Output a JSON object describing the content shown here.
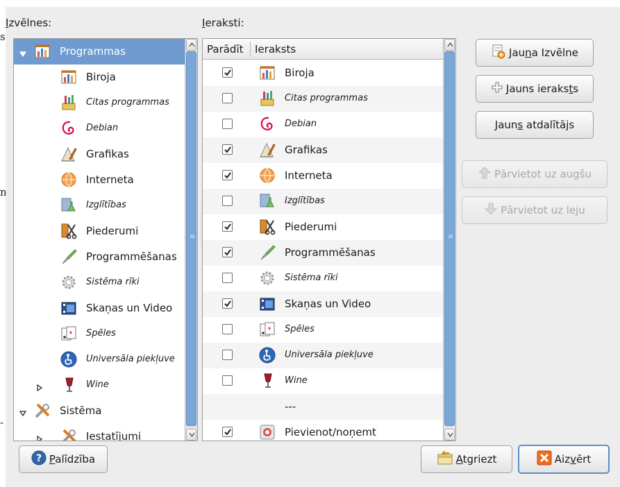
{
  "background": {
    "stray_glyphs": [
      "s",
      "n",
      "-"
    ]
  },
  "menus_panel": {
    "heading": "Izvēlnes:",
    "heading_mnemonic": "I",
    "heading_rest": "zvēlnes:",
    "items": [
      {
        "label": "Programmas",
        "icon": "office-chart-icon",
        "expander": "expanded",
        "selected": true,
        "italic": false,
        "level": 0
      },
      {
        "label": "Biroja",
        "icon": "office-chart-icon",
        "italic": false,
        "level": 1
      },
      {
        "label": "Citas programmas",
        "icon": "paint-brushes-icon",
        "italic": true,
        "level": 1
      },
      {
        "label": "Debian",
        "icon": "debian-swirl-icon",
        "italic": true,
        "level": 1
      },
      {
        "label": "Grafikas",
        "icon": "graphics-pen-icon",
        "italic": false,
        "level": 1
      },
      {
        "label": "Interneta",
        "icon": "internet-globe-icon",
        "italic": false,
        "level": 1
      },
      {
        "label": "Izglītības",
        "icon": "education-flask-icon",
        "italic": true,
        "level": 1
      },
      {
        "label": "Piederumi",
        "icon": "accessories-scissors-icon",
        "italic": false,
        "level": 1
      },
      {
        "label": "Programmēšanas",
        "icon": "trowel-icon",
        "italic": false,
        "level": 1
      },
      {
        "label": "Sistēma rīki",
        "icon": "gear-icon",
        "italic": true,
        "level": 1
      },
      {
        "label": "Skaņas un Video",
        "icon": "multimedia-film-icon",
        "italic": false,
        "level": 1
      },
      {
        "label": "Spēles",
        "icon": "playing-cards-icon",
        "italic": true,
        "level": 1
      },
      {
        "label": "Universāla piekļuve",
        "icon": "accessibility-icon",
        "italic": true,
        "level": 1
      },
      {
        "label": "Wine",
        "icon": "wine-glass-icon",
        "expander": "collapsed",
        "italic": true,
        "level": 1
      },
      {
        "label": "Sistēma",
        "icon": "tools-icon",
        "expander": "expanded",
        "italic": false,
        "level": 0
      },
      {
        "label": "Iestatījumi",
        "icon": "tools-icon",
        "expander": "collapsed",
        "italic": false,
        "level": 1
      }
    ]
  },
  "items_panel": {
    "heading": "Ieraksti:",
    "heading_mnemonic": "I",
    "heading_rest": "eraksti:",
    "columns": [
      "Parādīt",
      "Ieraksts"
    ],
    "rows": [
      {
        "show": true,
        "label": "Biroja",
        "icon": "office-chart-icon",
        "italic": false
      },
      {
        "show": false,
        "label": "Citas programmas",
        "icon": "paint-brushes-icon",
        "italic": true
      },
      {
        "show": false,
        "label": "Debian",
        "icon": "debian-swirl-icon",
        "italic": true
      },
      {
        "show": true,
        "label": "Grafikas",
        "icon": "graphics-pen-icon",
        "italic": false
      },
      {
        "show": true,
        "label": "Interneta",
        "icon": "internet-globe-icon",
        "italic": false
      },
      {
        "show": false,
        "label": "Izglītības",
        "icon": "education-flask-icon",
        "italic": true
      },
      {
        "show": true,
        "label": "Piederumi",
        "icon": "accessories-scissors-icon",
        "italic": false
      },
      {
        "show": true,
        "label": "Programmēšanas",
        "icon": "trowel-icon",
        "italic": false
      },
      {
        "show": false,
        "label": "Sistēma rīki",
        "icon": "gear-icon",
        "italic": true
      },
      {
        "show": true,
        "label": "Skaņas un Video",
        "icon": "multimedia-film-icon",
        "italic": false
      },
      {
        "show": false,
        "label": "Spēles",
        "icon": "playing-cards-icon",
        "italic": true
      },
      {
        "show": false,
        "label": "Universāla piekļuve",
        "icon": "accessibility-icon",
        "italic": true
      },
      {
        "show": false,
        "label": "Wine",
        "icon": "wine-glass-icon",
        "italic": true
      },
      {
        "separator": true,
        "label": "---"
      },
      {
        "show": true,
        "label": "Pievienot/noņemt",
        "icon": "add-remove-icon",
        "italic": false
      }
    ]
  },
  "actions": {
    "new_menu": {
      "label": "Jauna Izvēlne",
      "before": "Jau",
      "mnemonic": "n",
      "after": "a Izvēlne"
    },
    "new_item": {
      "label": "Jauns ieraksts",
      "before": "Jauns ieraks",
      "mnemonic": "t",
      "after": "s"
    },
    "new_separator": {
      "label": "Jauns atdalītājs",
      "before": "Jaun",
      "mnemonic": "s",
      "after": " atdalītājs"
    },
    "move_up": {
      "label": "Pārvietot uz augšu"
    },
    "move_down": {
      "label": "Pārvietot uz leju"
    }
  },
  "footer": {
    "help": {
      "label": "Palīdzība",
      "mnemonic": "P",
      "rest": "alīdzība"
    },
    "revert": {
      "label": "Atgriezt",
      "mnemonic": "A",
      "rest": "tgriezt"
    },
    "close": {
      "label": "Aizvērt",
      "before": "Aiz",
      "mnemonic": "v",
      "after": "ērt"
    }
  },
  "colors": {
    "selection": "#6f9bd1",
    "dialog_bg": "#ededed",
    "scroll_thumb": "#7aa7d8",
    "focus_border": "#5d8dc9"
  }
}
